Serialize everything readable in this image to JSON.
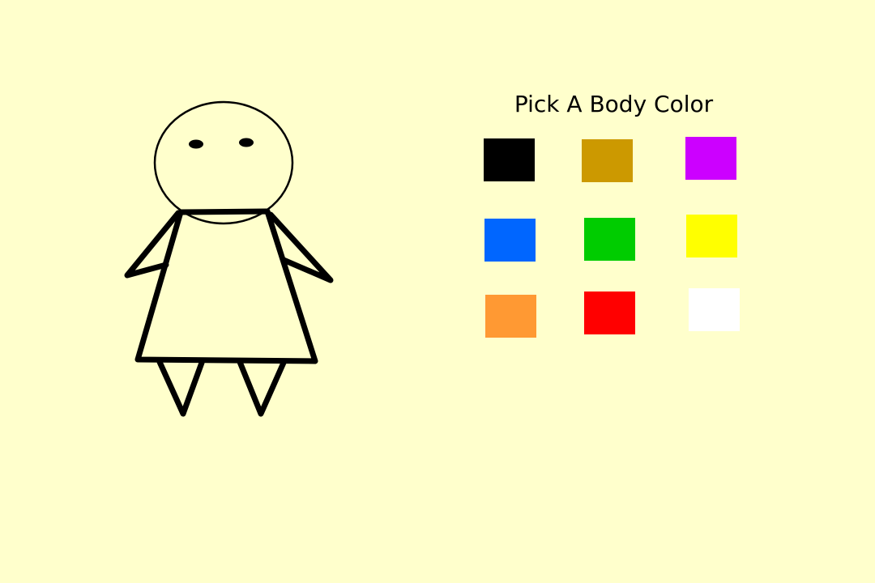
{
  "picker": {
    "title": "Pick A Body Color",
    "swatches": [
      {
        "name": "black",
        "color": "#000000"
      },
      {
        "name": "brown",
        "color": "#CC9900"
      },
      {
        "name": "purple",
        "color": "#CC00FF"
      },
      {
        "name": "blue",
        "color": "#0066FF"
      },
      {
        "name": "green",
        "color": "#00CC00"
      },
      {
        "name": "yellow",
        "color": "#FFFF00"
      },
      {
        "name": "orange",
        "color": "#FF9933"
      },
      {
        "name": "red",
        "color": "#FF0000"
      },
      {
        "name": "white",
        "color": "#FFFFFF"
      }
    ]
  },
  "colors": {
    "background": "#FFFFCC",
    "outline": "#000000"
  }
}
